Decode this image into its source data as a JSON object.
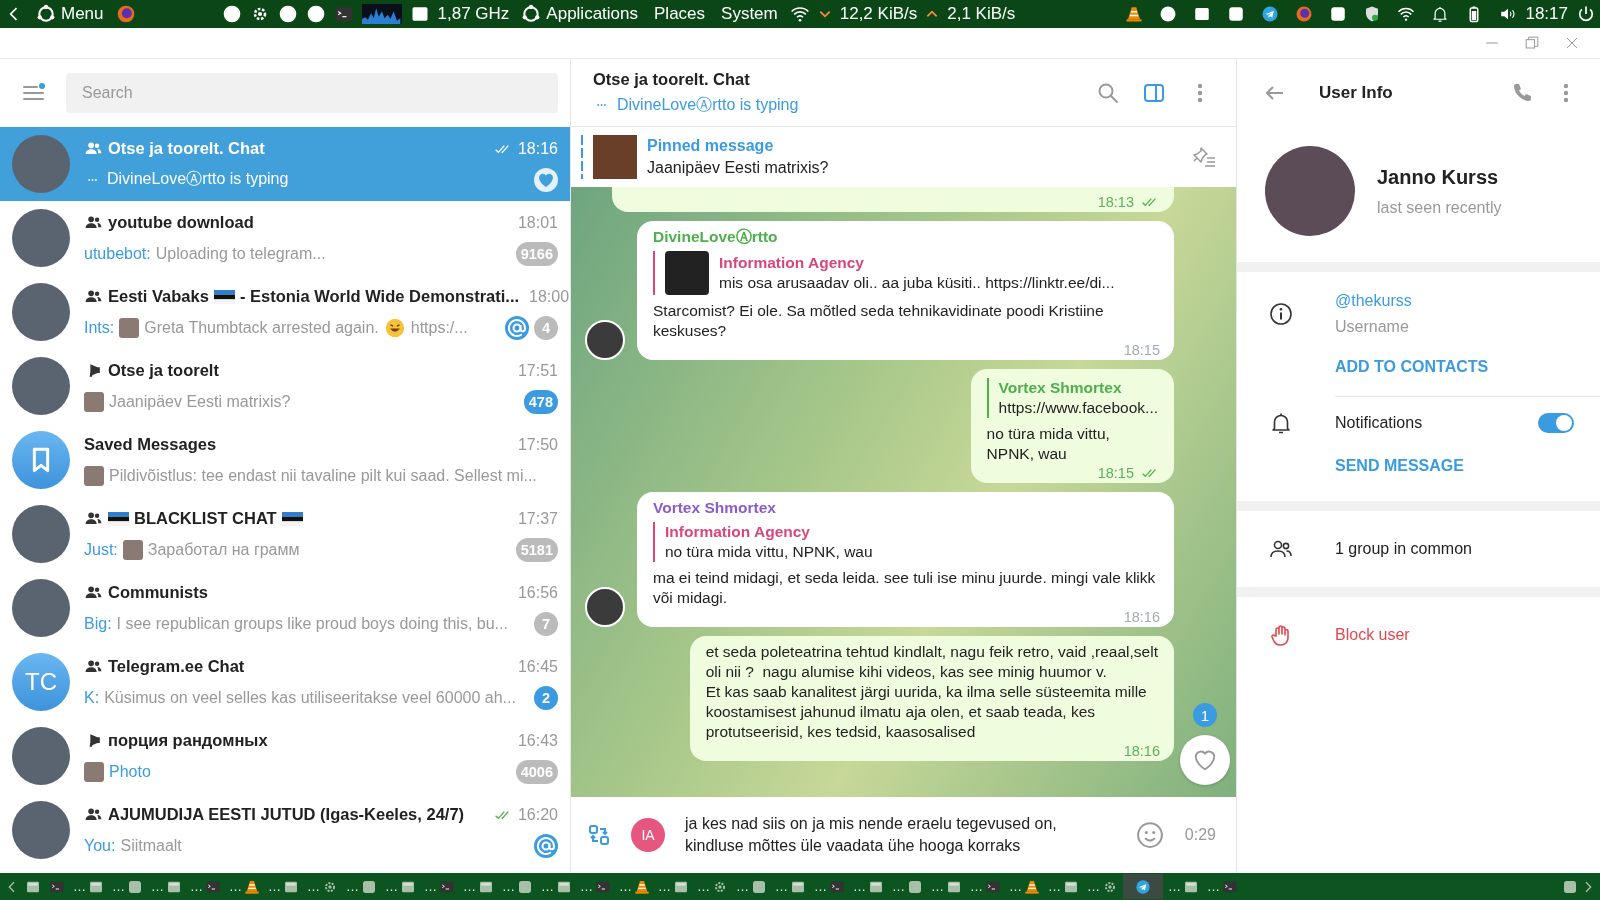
{
  "top_panel": {
    "menu": "Menu",
    "cpu": "1,87 GHz",
    "places": [
      "Applications",
      "Places",
      "System"
    ],
    "net_down": "12,2 KiB/s",
    "net_up": "2,1 KiB/s",
    "clock": "18:17"
  },
  "sidebar": {
    "search": {
      "placeholder": "Search"
    },
    "chats": [
      {
        "kind": "group",
        "title": [
          {
            "kind": "text",
            "text": "Otse ja toorelt. Chat"
          }
        ],
        "time": "18:16",
        "read": true,
        "selected": true,
        "avatar": {
          "kind": "photo"
        },
        "preview": [
          {
            "kind": "typing",
            "text": "DivineLoveⒶrtto is typing"
          }
        ],
        "reaction": true
      },
      {
        "kind": "group",
        "title": [
          {
            "kind": "text",
            "text": "youtube download"
          }
        ],
        "time": "18:01",
        "read": false,
        "selected": false,
        "avatar": {
          "kind": "photo"
        },
        "preview": [
          {
            "kind": "sender",
            "text": "utubebot:"
          },
          {
            "kind": "text",
            "text": "Uploading to telegram..."
          }
        ],
        "badge": "9166",
        "badge_muted": true
      },
      {
        "kind": "group",
        "title": [
          {
            "kind": "text",
            "text": "Eesti Vabaks"
          },
          {
            "kind": "flag"
          },
          {
            "kind": "text",
            "text": " - Estonia World Wide Demonstrati..."
          }
        ],
        "time": "18:00",
        "read": false,
        "selected": false,
        "avatar": {
          "kind": "photo"
        },
        "preview": [
          {
            "kind": "sender",
            "text": "Ints:"
          },
          {
            "kind": "thumb"
          },
          {
            "kind": "text",
            "text": "Greta Thumbtack arrested again."
          },
          {
            "kind": "emoji"
          },
          {
            "kind": "text",
            "text": "https:/..."
          }
        ],
        "mention": true,
        "badge": "4",
        "badge_muted": true
      },
      {
        "kind": "channel",
        "title": [
          {
            "kind": "text",
            "text": "Otse ja toorelt"
          }
        ],
        "time": "17:51",
        "read": false,
        "selected": false,
        "avatar": {
          "kind": "photo"
        },
        "preview": [
          {
            "kind": "thumb"
          },
          {
            "kind": "text",
            "text": "Jaanipäev Eesti matrixis?"
          }
        ],
        "badge": "478",
        "badge_muted": false
      },
      {
        "kind": "saved",
        "title": [
          {
            "kind": "text",
            "text": "Saved Messages"
          }
        ],
        "time": "17:50",
        "read": false,
        "selected": false,
        "avatar": {
          "kind": "saved"
        },
        "preview": [
          {
            "kind": "thumb"
          },
          {
            "kind": "text",
            "text": "Pildivõistlus: tee endast nii tavaline pilt kui saad. Sellest mi..."
          }
        ]
      },
      {
        "kind": "group",
        "title": [
          {
            "kind": "flag"
          },
          {
            "kind": "text",
            "text": "BLACKLIST CHAT"
          },
          {
            "kind": "flag"
          }
        ],
        "time": "17:37",
        "read": false,
        "selected": false,
        "avatar": {
          "kind": "photo"
        },
        "preview": [
          {
            "kind": "sender",
            "text": "Just:"
          },
          {
            "kind": "thumb"
          },
          {
            "kind": "text",
            "text": "Заработал на грамм"
          }
        ],
        "badge": "5181",
        "badge_muted": true
      },
      {
        "kind": "group",
        "title": [
          {
            "kind": "text",
            "text": "Communists"
          }
        ],
        "time": "16:56",
        "read": false,
        "selected": false,
        "avatar": {
          "kind": "photo"
        },
        "preview": [
          {
            "kind": "sender",
            "text": "Big:"
          },
          {
            "kind": "text",
            "text": "I see republican groups like proud boys doing this, bu..."
          }
        ],
        "badge": "7",
        "badge_muted": true
      },
      {
        "kind": "group",
        "title": [
          {
            "kind": "text",
            "text": "Telegram.ee Chat"
          }
        ],
        "time": "16:45",
        "read": false,
        "selected": false,
        "avatar": {
          "kind": "initials",
          "text": "TC"
        },
        "preview": [
          {
            "kind": "sender",
            "text": "K:"
          },
          {
            "kind": "text",
            "text": "Küsimus on veel selles kas utiliseeritakse veel 60000 ah..."
          }
        ],
        "badge": "2",
        "badge_muted": false
      },
      {
        "kind": "channel",
        "title": [
          {
            "kind": "text",
            "text": "порция рандомных"
          }
        ],
        "time": "16:43",
        "read": false,
        "selected": false,
        "avatar": {
          "kind": "photo"
        },
        "preview": [
          {
            "kind": "thumb"
          },
          {
            "kind": "media",
            "text": "Photo"
          }
        ],
        "badge": "4006",
        "badge_muted": true
      },
      {
        "kind": "group",
        "title": [
          {
            "kind": "text",
            "text": "AJUMUDIJA EESTI JUTUD (Igas-Keeles, 24/7)"
          }
        ],
        "time": "16:20",
        "read": true,
        "selected": false,
        "avatar": {
          "kind": "photo"
        },
        "preview": [
          {
            "kind": "sender",
            "text": "You:"
          },
          {
            "kind": "text",
            "text": "Siitmaalt"
          }
        ],
        "mention": true
      }
    ]
  },
  "chat": {
    "title": "Otse ja toorelt. Chat",
    "status": "DivineLoveⒶrtto is typing",
    "pinned": {
      "label": "Pinned message",
      "text": "Jaanipäev Eesti matrixis?"
    },
    "messages": [
      {
        "kind": "out",
        "stub": true,
        "time": "18:13",
        "read": true
      },
      {
        "kind": "in",
        "sender": "DivineLoveⒶrtto",
        "color": "#4fae4e",
        "reply": {
          "name": "Information Agency",
          "text": "mis osa arusaadav oli.. aa juba küsiti..  https://linktr.ee/di...",
          "color": "#d9467c",
          "thumb": true
        },
        "text": "Starcomist? Ei ole. Sa mõtled seda tehnikavidinate poodi Kristiine keskuses?",
        "time": "18:15"
      },
      {
        "kind": "out",
        "reply": {
          "name": "Vortex Shmortex",
          "text": "https://www.facebook...",
          "color": "#4fae4e"
        },
        "text": "no türa mida vittu,\nNPNK, wau",
        "time": "18:15",
        "read": true
      },
      {
        "kind": "in",
        "sender": "Vortex Shmortex",
        "color": "#8a5cc7",
        "reply": {
          "name": "Information Agency",
          "text": "no türa mida vittu,  NPNK, wau",
          "color": "#d9467c"
        },
        "text": "ma ei teind midagi, et seda leida. see tuli ise minu juurde. mingi vale klikk või midagi.",
        "time": "18:16"
      },
      {
        "kind": "out",
        "text": "et seda poleteatrina tehtud kindlalt, nagu feik retro, vaid ,reaal,selt\noli nii ?  nagu alumise kihi videos, kas see minig huumor v.\nEt kas saab kanalitest järgi uurida, ka ilma selle süsteemita mille\nkoostamisest jahunud ilmatu aja olen, et saab teada, kes\nprotutseerisid, kes tedsid, kaasosalised",
        "time": "18:16"
      }
    ],
    "unread_reactions": "1",
    "composer": {
      "avatar": "IA",
      "value": "ja kes nad siis on ja mis nende eraelu tegevused on,\nkindluse mõttes üle vaadata ühe hooga korraks",
      "timer": "0:29"
    }
  },
  "user_info": {
    "title": "User Info",
    "name": "Janno Kurss",
    "status": "last seen recently",
    "username": "@thekurss",
    "username_label": "Username",
    "add_contact": "ADD TO CONTACTS",
    "notifications": {
      "label": "Notifications",
      "on": true
    },
    "send_message": "SEND MESSAGE",
    "groups": "1 group in common",
    "block": "Block user"
  },
  "taskbar": {
    "items": [
      {
        "selected": false
      },
      {
        "selected": false
      },
      {
        "label": "…",
        "selected": false
      },
      {
        "label": "…",
        "selected": false
      },
      {
        "label": "…",
        "selected": false
      },
      {
        "label": "…",
        "selected": false
      },
      {
        "label": "…",
        "selected": false
      },
      {
        "label": "…",
        "selected": false
      },
      {
        "label": "…",
        "selected": false
      },
      {
        "label": "…",
        "selected": false
      },
      {
        "label": "…",
        "selected": false
      },
      {
        "label": "…",
        "selected": false
      },
      {
        "label": "…",
        "selected": false
      },
      {
        "label": "…",
        "selected": false
      },
      {
        "label": "…",
        "selected": false
      },
      {
        "label": "…",
        "selected": false
      },
      {
        "label": "…",
        "selected": false
      },
      {
        "label": "…",
        "selected": false
      },
      {
        "label": "…",
        "selected": false
      },
      {
        "label": "…",
        "selected": false
      },
      {
        "label": "…",
        "selected": false
      },
      {
        "label": "…",
        "selected": false
      },
      {
        "label": "…",
        "selected": false
      },
      {
        "label": "…",
        "selected": false
      },
      {
        "label": "…",
        "selected": false
      },
      {
        "label": "…",
        "selected": false
      },
      {
        "label": "…",
        "selected": false
      },
      {
        "label": "…",
        "selected": false
      },
      {
        "label": "…",
        "selected": false
      },
      {
        "selected": true
      },
      {
        "label": "…",
        "selected": false
      },
      {
        "label": "…",
        "selected": false
      }
    ]
  }
}
